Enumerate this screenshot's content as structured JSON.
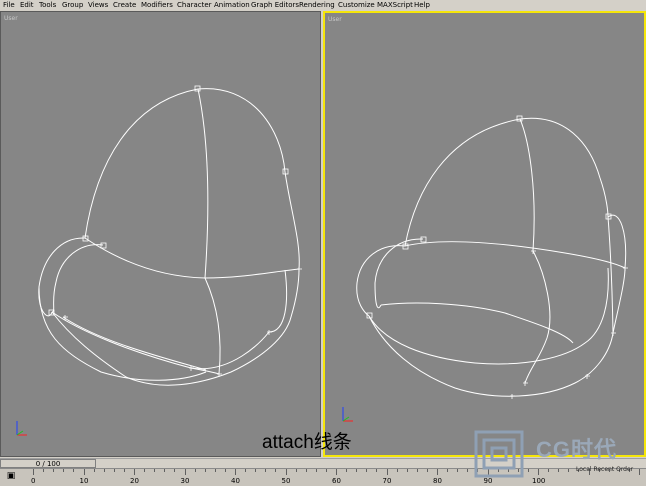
{
  "menu": [
    "File",
    "Edit",
    "Tools",
    "Group",
    "Views",
    "Create",
    "Modifiers",
    "Character",
    "Animation",
    "Graph Editors",
    "Rendering",
    "Customize",
    "MAXScript",
    "Help"
  ],
  "viewports": {
    "left": {
      "label": "User"
    },
    "right": {
      "label": "User"
    }
  },
  "caption": "attach线条",
  "time_slider": {
    "value": "0 / 100"
  },
  "ruler": {
    "ticks": [
      "0",
      "10",
      "20",
      "30",
      "40",
      "50",
      "60",
      "70",
      "80",
      "90",
      "100"
    ]
  },
  "watermark": {
    "brand": "CG时代",
    "subtext": "Local Recent Order"
  },
  "colors": {
    "viewport_bg": "#868686",
    "active_border": "#f5e60a",
    "wire": "#ffffff"
  }
}
